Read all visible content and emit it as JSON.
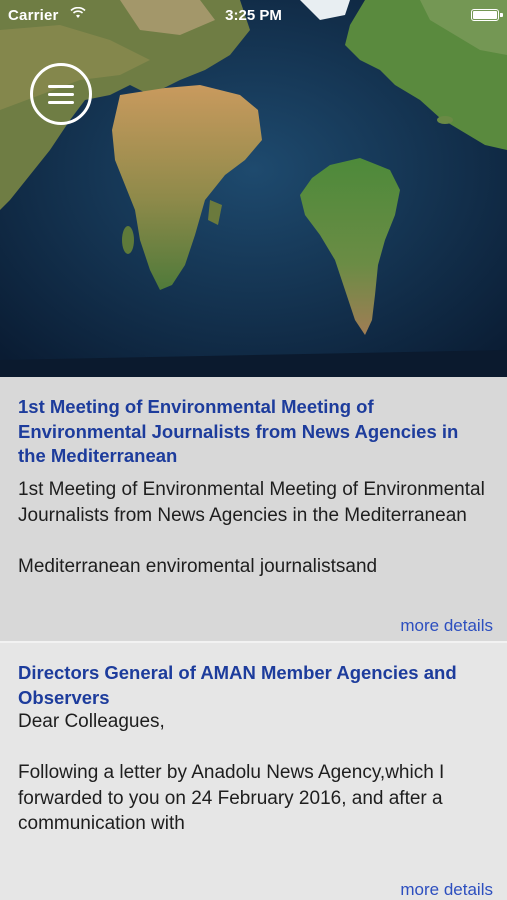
{
  "status_bar": {
    "carrier": "Carrier",
    "wifi": "wifi-icon",
    "time": "3:25 PM",
    "battery": "battery-icon"
  },
  "hero": {
    "image": "world-map",
    "menu_icon": "hamburger-menu-icon"
  },
  "news": [
    {
      "title": "1st Meeting of Environmental Meeting of Environmental Journalists from News Agencies in the Mediterranean",
      "body": "1st Meeting of Environmental Meeting of Environmental Journalists from News Agencies in the Mediterranean\n\nMediterranean enviromental journalistsand",
      "more": "more details"
    },
    {
      "title": "Directors General of AMAN Member Agencies and Observers",
      "body": "Dear Colleagues,\n\nFollowing a letter by Anadolu News Agency,which I forwarded to you on 24 February 2016, and after a communication with",
      "more": "more details"
    }
  ],
  "colors": {
    "title": "#1d3c9c",
    "link": "#2d4fbf",
    "card1_bg": "#d8d8d8",
    "card2_bg": "#e6e6e6"
  }
}
